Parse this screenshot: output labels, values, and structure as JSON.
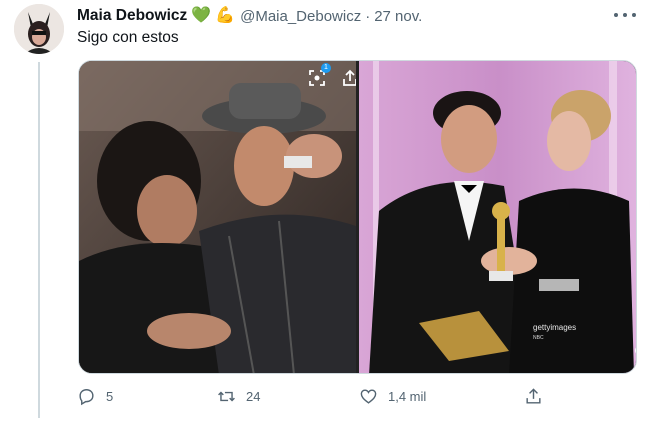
{
  "tweet": {
    "author_name": "Maia Debowicz",
    "emojis": [
      "green-heart",
      "flexed-biceps"
    ],
    "handle": "@Maia_Debowicz",
    "separator": "·",
    "date": "27 nov.",
    "text": "Sigo con estos"
  },
  "media": {
    "badge_count": "1",
    "watermark": "gettyimages",
    "watermark_credit": "NBC"
  },
  "actions": {
    "reply_count": "5",
    "retweet_count": "24",
    "like_count": "1,4 mil"
  },
  "colors": {
    "secondary_text": "#536471",
    "thread_line": "#cfd9de",
    "badge_blue": "#1d9bf0"
  }
}
